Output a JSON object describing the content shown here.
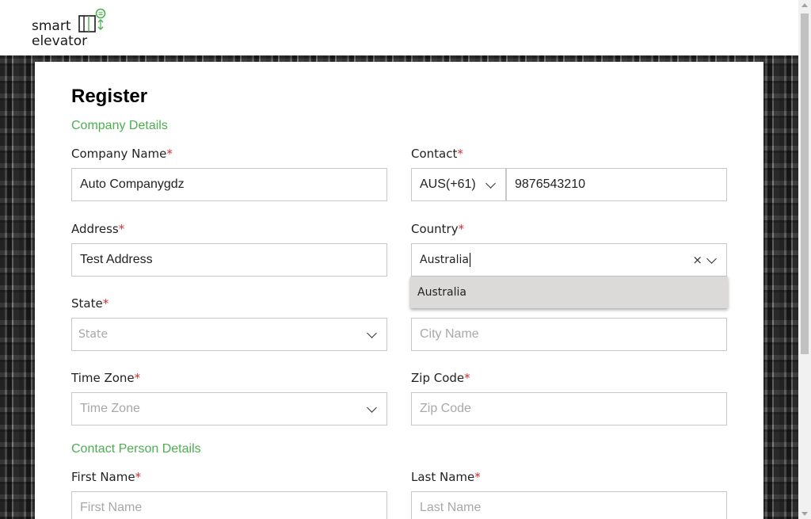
{
  "logo": {
    "line1": "smart",
    "line2": "elevator"
  },
  "page": {
    "title": "Register"
  },
  "sections": {
    "company": "Company Details",
    "contact_person": "Contact Person Details"
  },
  "required_mark": "*",
  "fields": {
    "company_name": {
      "label": "Company Name",
      "value": "Auto Companygdz"
    },
    "contact": {
      "label": "Contact",
      "country_code": "AUS(+61)",
      "value": "9876543210"
    },
    "address": {
      "label": "Address",
      "value": "Test Address"
    },
    "country": {
      "label": "Country",
      "value": "Australia",
      "clear": "×",
      "options": [
        "Australia"
      ]
    },
    "state": {
      "label": "State",
      "placeholder": "State"
    },
    "city": {
      "placeholder": "City Name"
    },
    "time_zone": {
      "label": "Time Zone",
      "placeholder": "Time Zone"
    },
    "zip_code": {
      "label": "Zip Code",
      "placeholder": "Zip Code"
    },
    "first_name": {
      "label": "First Name",
      "placeholder": "First Name"
    },
    "last_name": {
      "label": "Last Name",
      "placeholder": "Last Name"
    }
  },
  "colors": {
    "accent_green": "#4caf50",
    "required_red": "#d32f2f"
  }
}
